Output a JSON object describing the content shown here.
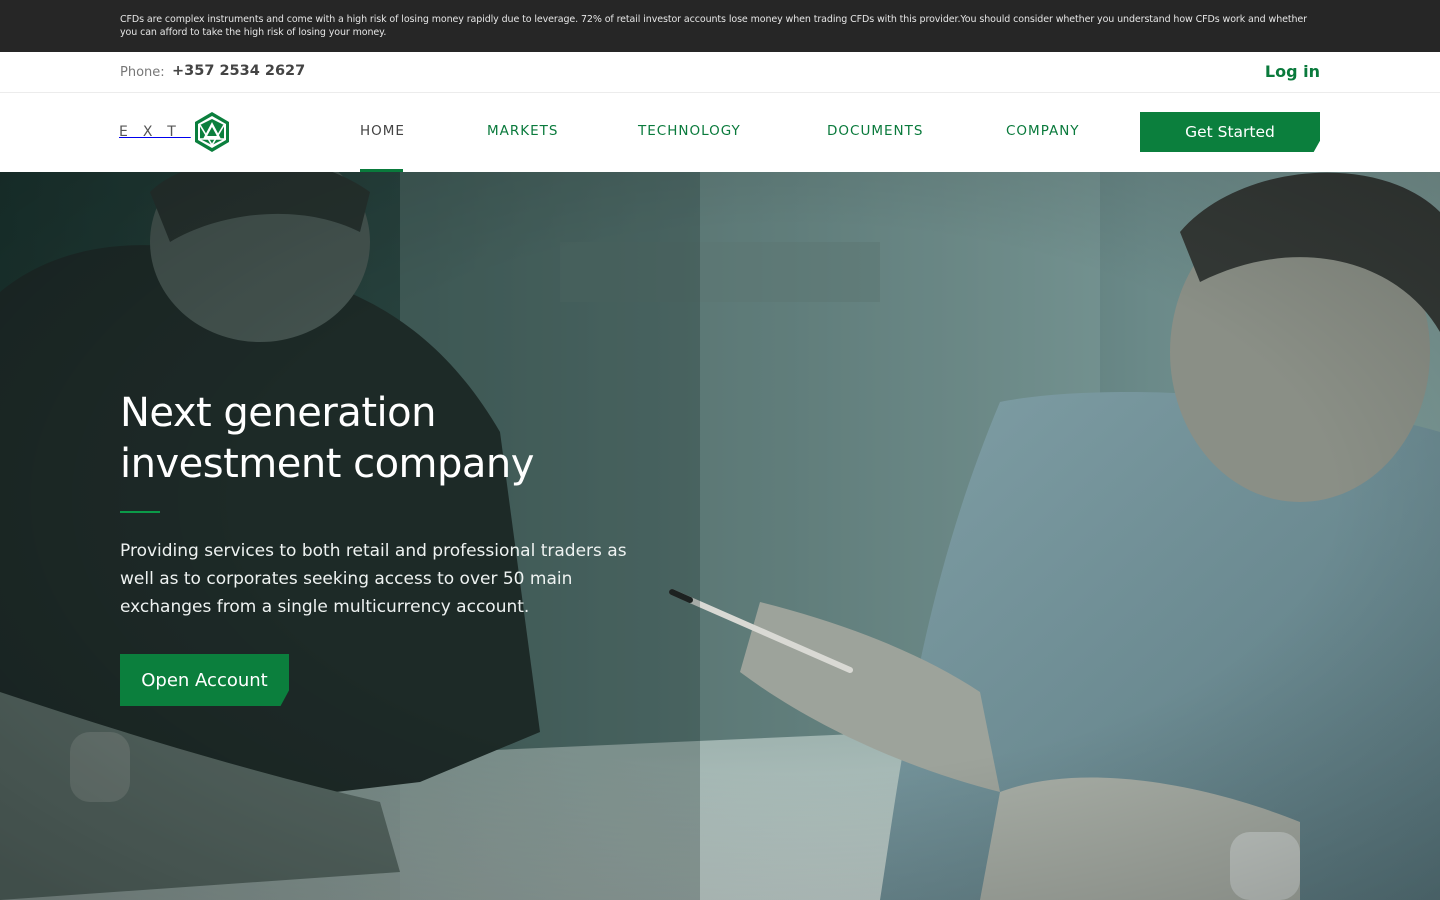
{
  "risk_warning": "CFDs are complex instruments and come with a high risk of losing money rapidly due to leverage. 72% of retail investor accounts lose money when trading CFDs with this provider.You should consider whether you understand how CFDs work and whether you can afford to take the high risk of losing your money.",
  "contact": {
    "phone_label": "Phone:",
    "phone_number": "+357 2534 2627",
    "login_label": "Log in"
  },
  "brand": {
    "logo_text": "EXT",
    "logo_icon": "hexagon-triangle-logo-icon"
  },
  "nav": {
    "items": [
      {
        "label": "HOME",
        "active": true
      },
      {
        "label": "MARKETS",
        "active": false
      },
      {
        "label": "TECHNOLOGY",
        "active": false
      },
      {
        "label": "DOCUMENTS",
        "active": false
      },
      {
        "label": "COMPANY",
        "active": false
      }
    ],
    "cta_label": "Get Started"
  },
  "hero": {
    "title_line1": "Next generation",
    "title_line2": "investment company",
    "description": "Providing services to both retail and professional traders as well as to corporates seeking access to over 50 main exchanges from a single multicurrency account.",
    "button_label": "Open Account"
  },
  "colors": {
    "accent": "#0b7f3d",
    "risk_bar_bg": "#262626",
    "hero_overlay": "#2f4b47"
  }
}
